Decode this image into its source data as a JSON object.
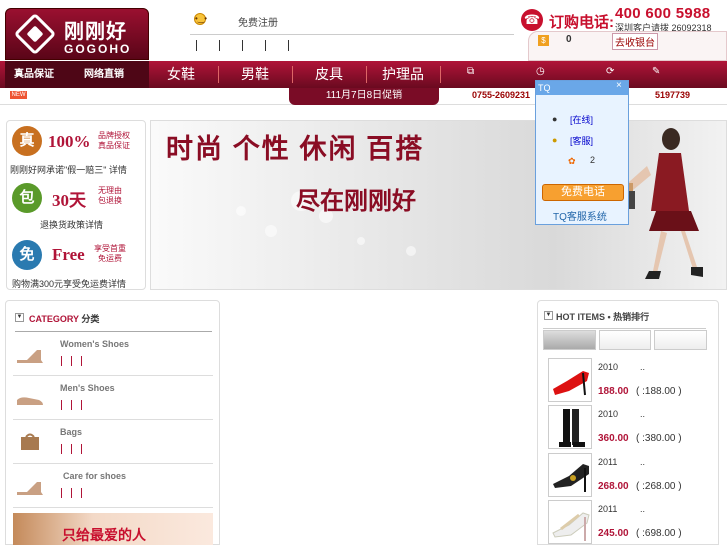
{
  "header": {
    "logo_cn": "刚刚好",
    "logo_en": "GOGOHO",
    "register": "免费注册",
    "order_label": "订购电话:",
    "order_phone": "400 600 5988",
    "shenzhen": "深圳客户请拨 26092318",
    "cart_count": "0",
    "checkout": "去收银台"
  },
  "nav": {
    "left_items": [
      "真品保证",
      "网络直销"
    ],
    "items": [
      "女鞋",
      "男鞋",
      "皮具",
      "护理品"
    ]
  },
  "subbar": {
    "new_tag": "NEW",
    "tab_text": "111月7日8日促销",
    "hotline": "0755-2609231",
    "hotline2": "5197739"
  },
  "promo": {
    "block1": {
      "circle": "真",
      "big": "100%",
      "small1": "品牌授权",
      "small2": "真品保证",
      "link": "刚刚好网承诺\"假一赔三\" 详情"
    },
    "block2": {
      "circle": "包",
      "big": "30天",
      "small1": "无理由",
      "small2": "包退换",
      "link": "退换货政策详情"
    },
    "block3": {
      "circle": "免",
      "big": "Free",
      "small1": "享受首重",
      "small2": "免运费",
      "link": "购物满300元享受免运费详情"
    }
  },
  "banner": {
    "title": "时尚 个性 休闲 百搭",
    "subtitle": "尽在刚刚好"
  },
  "tq": {
    "head": "TQ",
    "close": "×",
    "row1": "[在线]",
    "row2": "[客服]",
    "row3": "2",
    "call": "免费电话",
    "footer": "TQ客服系统"
  },
  "category": {
    "label_en": "CATEGORY",
    "label_cn": "分类",
    "items": [
      {
        "name": "Women's Shoes"
      },
      {
        "name": "Men's Shoes"
      },
      {
        "name": "Bags"
      },
      {
        "name": "Care for shoes"
      }
    ]
  },
  "gift": {
    "text": "只给最爱的人"
  },
  "hot": {
    "label_en": "HOT ITEMS",
    "label_cn": "• 热销排行",
    "items": [
      {
        "year": "2010",
        "dot": "..",
        "price": "188.00",
        "orig": "( :188.00 )"
      },
      {
        "year": "2010",
        "dot": "..",
        "price": "360.00",
        "orig": "( :380.00 )"
      },
      {
        "year": "2011",
        "dot": "..",
        "price": "268.00",
        "orig": "( :268.00 )"
      },
      {
        "year": "2011",
        "dot": "..",
        "price": "245.00",
        "orig": "( :698.00 )"
      }
    ]
  },
  "colors": {
    "brand": "#b01438",
    "accent_red": "#c8102e",
    "tq_blue": "#6aa7e8"
  }
}
